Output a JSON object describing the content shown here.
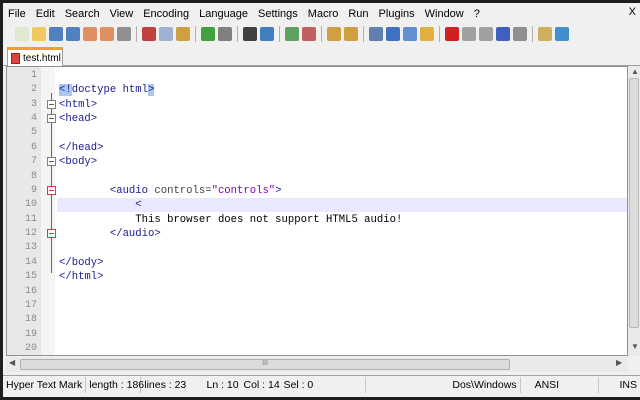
{
  "menu": [
    "File",
    "Edit",
    "Search",
    "View",
    "Encoding",
    "Language",
    "Settings",
    "Macro",
    "Run",
    "Plugins",
    "Window",
    "?"
  ],
  "close_label": "X",
  "toolbar_icons": [
    "new-file",
    "open-file",
    "save",
    "save-all",
    "close",
    "close-all",
    "print",
    "cut",
    "copy",
    "paste",
    "undo",
    "redo",
    "find",
    "replace",
    "zoom-in",
    "zoom-out",
    "sync-vertical",
    "sync-horizontal",
    "word-wrap",
    "show-all-chars",
    "indent-guide",
    "doc-map",
    "record-macro",
    "stop-macro",
    "play-macro",
    "run-macro-multiple",
    "save-macro",
    "folder-as-workspace",
    "spell-check"
  ],
  "tab": {
    "label": "test.html"
  },
  "editor": {
    "current_line": 10,
    "lines": [
      [],
      [
        {
          "t": "<!",
          "c": "tag hl"
        },
        {
          "t": "doctype html",
          "c": "tag"
        },
        {
          "t": ">",
          "c": "tag hl"
        }
      ],
      [
        {
          "t": "<html>",
          "c": "tag"
        }
      ],
      [
        {
          "t": "<head>",
          "c": "tag"
        }
      ],
      [],
      [
        {
          "t": "</head>",
          "c": "tag"
        }
      ],
      [
        {
          "t": "<body>",
          "c": "tag"
        }
      ],
      [],
      [
        {
          "t": "        "
        },
        {
          "t": "<audio ",
          "c": "tag"
        },
        {
          "t": "controls=",
          "c": "attr"
        },
        {
          "t": "\"controls\"",
          "c": "val"
        },
        {
          "t": ">",
          "c": "tag"
        }
      ],
      [
        {
          "t": "            "
        },
        {
          "t": "<",
          "c": "tag"
        }
      ],
      [
        {
          "t": "            "
        },
        {
          "t": "This browser does not support HTML5 audio!",
          "c": "txt"
        }
      ],
      [
        {
          "t": "        "
        },
        {
          "t": "</audio>",
          "c": "tag"
        }
      ],
      [],
      [
        {
          "t": "</body>",
          "c": "tag"
        }
      ],
      [
        {
          "t": "</html>",
          "c": "tag"
        }
      ],
      [],
      [],
      [],
      [],
      []
    ],
    "fold_markers": [
      3,
      4,
      7,
      9,
      12
    ]
  },
  "hscroll_grip": "III",
  "status": {
    "lang": "Hyper Text Mark",
    "length": "length : 186",
    "lines": "lines : 23",
    "ln": "Ln : 10",
    "col": "Col : 14",
    "sel": "Sel : 0",
    "eol": "Dos\\Windows",
    "encoding": "ANSI",
    "mode": "INS"
  }
}
